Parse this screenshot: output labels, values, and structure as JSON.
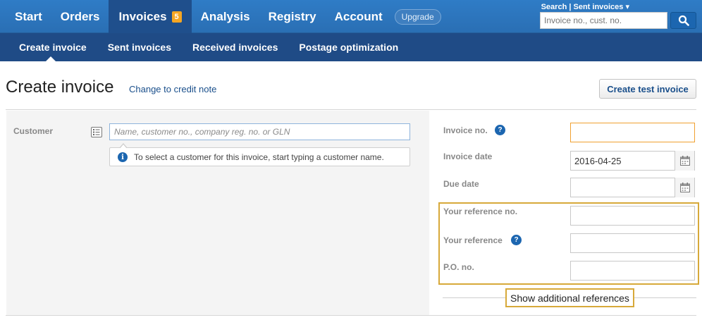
{
  "nav": {
    "items": [
      {
        "label": "Start"
      },
      {
        "label": "Orders"
      },
      {
        "label": "Invoices",
        "badge": "5"
      },
      {
        "label": "Analysis"
      },
      {
        "label": "Registry"
      },
      {
        "label": "Account"
      }
    ],
    "upgrade": "Upgrade",
    "search_link": "Search",
    "sent_invoices_link": "Sent invoices",
    "search_placeholder": "Invoice no., cust. no."
  },
  "subnav": {
    "items": [
      {
        "label": "Create invoice"
      },
      {
        "label": "Sent invoices"
      },
      {
        "label": "Received invoices"
      },
      {
        "label": "Postage optimization"
      }
    ]
  },
  "header": {
    "title": "Create invoice",
    "credit_link": "Change to credit note",
    "test_button": "Create test invoice"
  },
  "customer": {
    "label": "Customer",
    "placeholder": "Name, customer no., company reg. no. or GLN",
    "hint": "To select a customer for this invoice, start typing a customer name."
  },
  "fields": {
    "invoice_no": {
      "label": "Invoice no.",
      "value": ""
    },
    "invoice_date": {
      "label": "Invoice date",
      "value": "2016-04-25"
    },
    "due_date": {
      "label": "Due date",
      "value": ""
    },
    "your_ref_no": {
      "label": "Your reference no.",
      "value": ""
    },
    "your_ref": {
      "label": "Your reference",
      "value": ""
    },
    "po_no": {
      "label": "P.O. no.",
      "value": ""
    }
  },
  "show_refs": "Show additional references",
  "colors": {
    "nav_blue": "#2f7cc6",
    "subnav_blue": "#1f4b86",
    "badge": "#f5a623",
    "highlight": "#d7a93a"
  }
}
